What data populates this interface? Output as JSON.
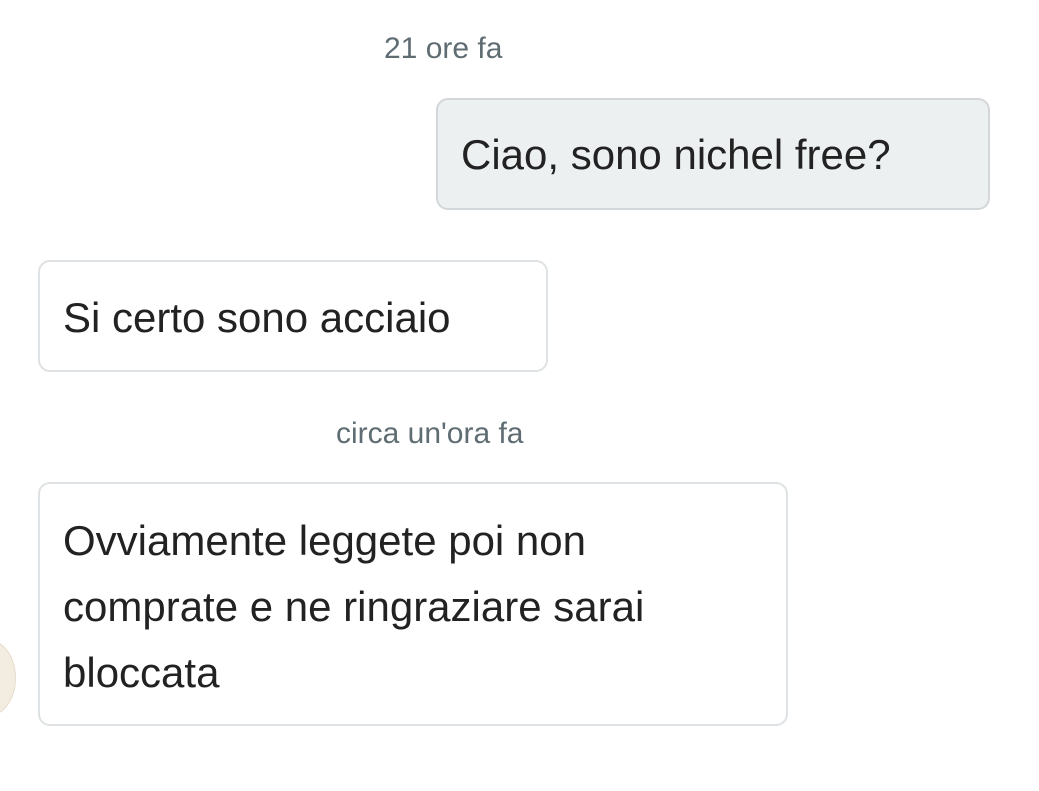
{
  "chat": {
    "messages": [
      {
        "timestamp": "21 ore fa",
        "direction": "sent",
        "text": "Ciao, sono nichel free?"
      },
      {
        "direction": "received",
        "text": "Si certo sono acciaio"
      },
      {
        "timestamp": "circa un'ora fa",
        "direction": "received",
        "text": "Ovviamente leggete poi non comprate e ne ringraziare sarai bloccata"
      }
    ]
  },
  "colors": {
    "sent_bubble_bg": "#edf0f1",
    "received_bubble_bg": "#ffffff",
    "timestamp_text": "#5f6d73"
  }
}
